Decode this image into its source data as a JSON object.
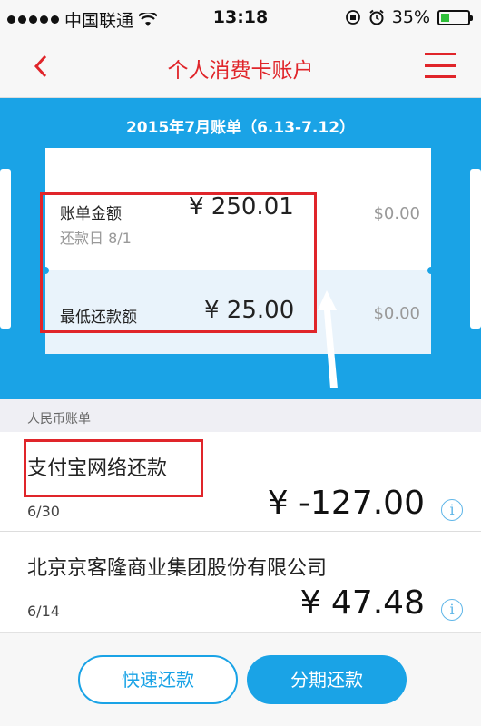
{
  "status_bar": {
    "carrier": "中国联通",
    "time": "13:18",
    "battery": "35%"
  },
  "nav": {
    "title": "个人消费卡账户"
  },
  "bill": {
    "header": "2015年7月账单（6.13-7.12）",
    "amount_label": "账单金额",
    "amount_value": "¥ 250.01",
    "due_label": "还款日 8/1",
    "min_label": "最低还款额",
    "min_value": "¥ 25.00",
    "usd_amount": "$0.00",
    "usd_min": "$0.00"
  },
  "section": {
    "title": "人民币账单"
  },
  "transactions": [
    {
      "name": "支付宝网络还款",
      "date": "6/30",
      "amount": "¥ -127.00"
    },
    {
      "name": "北京京客隆商业集团股份有限公司",
      "date": "6/14",
      "amount": "¥ 47.48"
    }
  ],
  "buttons": {
    "quick_repay": "快速还款",
    "installment": "分期还款"
  },
  "colors": {
    "accent_red": "#e0252a",
    "accent_blue": "#1aa3e6"
  }
}
